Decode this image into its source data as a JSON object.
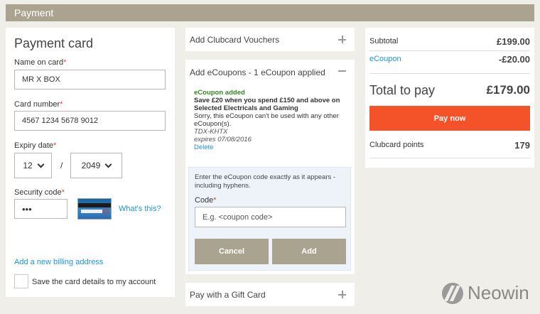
{
  "header": {
    "title": "Payment"
  },
  "card": {
    "title": "Payment card",
    "name_label": "Name on card",
    "name_value": "MR X BOX",
    "number_label": "Card number",
    "number_value": "4567 1234 5678 9012",
    "expiry_label": "Expiry date",
    "expiry_month": "12",
    "expiry_sep": "/",
    "expiry_year": "2049",
    "security_label": "Security code",
    "security_value": "•••",
    "whats_this": "What's this?",
    "billing_link": "Add a new billing address",
    "save_label": "Save the card details to my account",
    "required_mark": "*"
  },
  "vouchers": {
    "clubcard_title": "Add Clubcard Vouchers",
    "gift_title": "Pay with a Gift Card"
  },
  "ecoupons": {
    "title": "Add eCoupons - 1 eCoupon applied",
    "added": "eCoupon added",
    "description": "Save £20 when you spend £150 and above on Selected Electricals and Gaming",
    "note": "Sorry, this eCoupon can't be used with any other eCoupon(s).",
    "code": "TDX-KHTX",
    "expires": "expires 07/08/2016",
    "delete": "Delete",
    "instructions": "Enter the eCoupon code exactly as it appears - including hyphens.",
    "code_label": "Code",
    "code_placeholder": "E.g. <coupon code>",
    "cancel": "Cancel",
    "add": "Add"
  },
  "summary": {
    "subtotal_label": "Subtotal",
    "subtotal_value": "£199.00",
    "ecoupon_label": "eCoupon",
    "ecoupon_value": "-£20.00",
    "total_label": "Total to pay",
    "total_value": "£179.00",
    "pay_now": "Pay now",
    "clubcard_label": "Clubcard points",
    "clubcard_value": "179"
  },
  "watermark": {
    "text": "Neowin"
  },
  "colors": {
    "header": "#aaa390",
    "accent": "#f4532a",
    "link": "#1a97d4",
    "success": "#2f8a1e",
    "required": "#e5432e"
  }
}
